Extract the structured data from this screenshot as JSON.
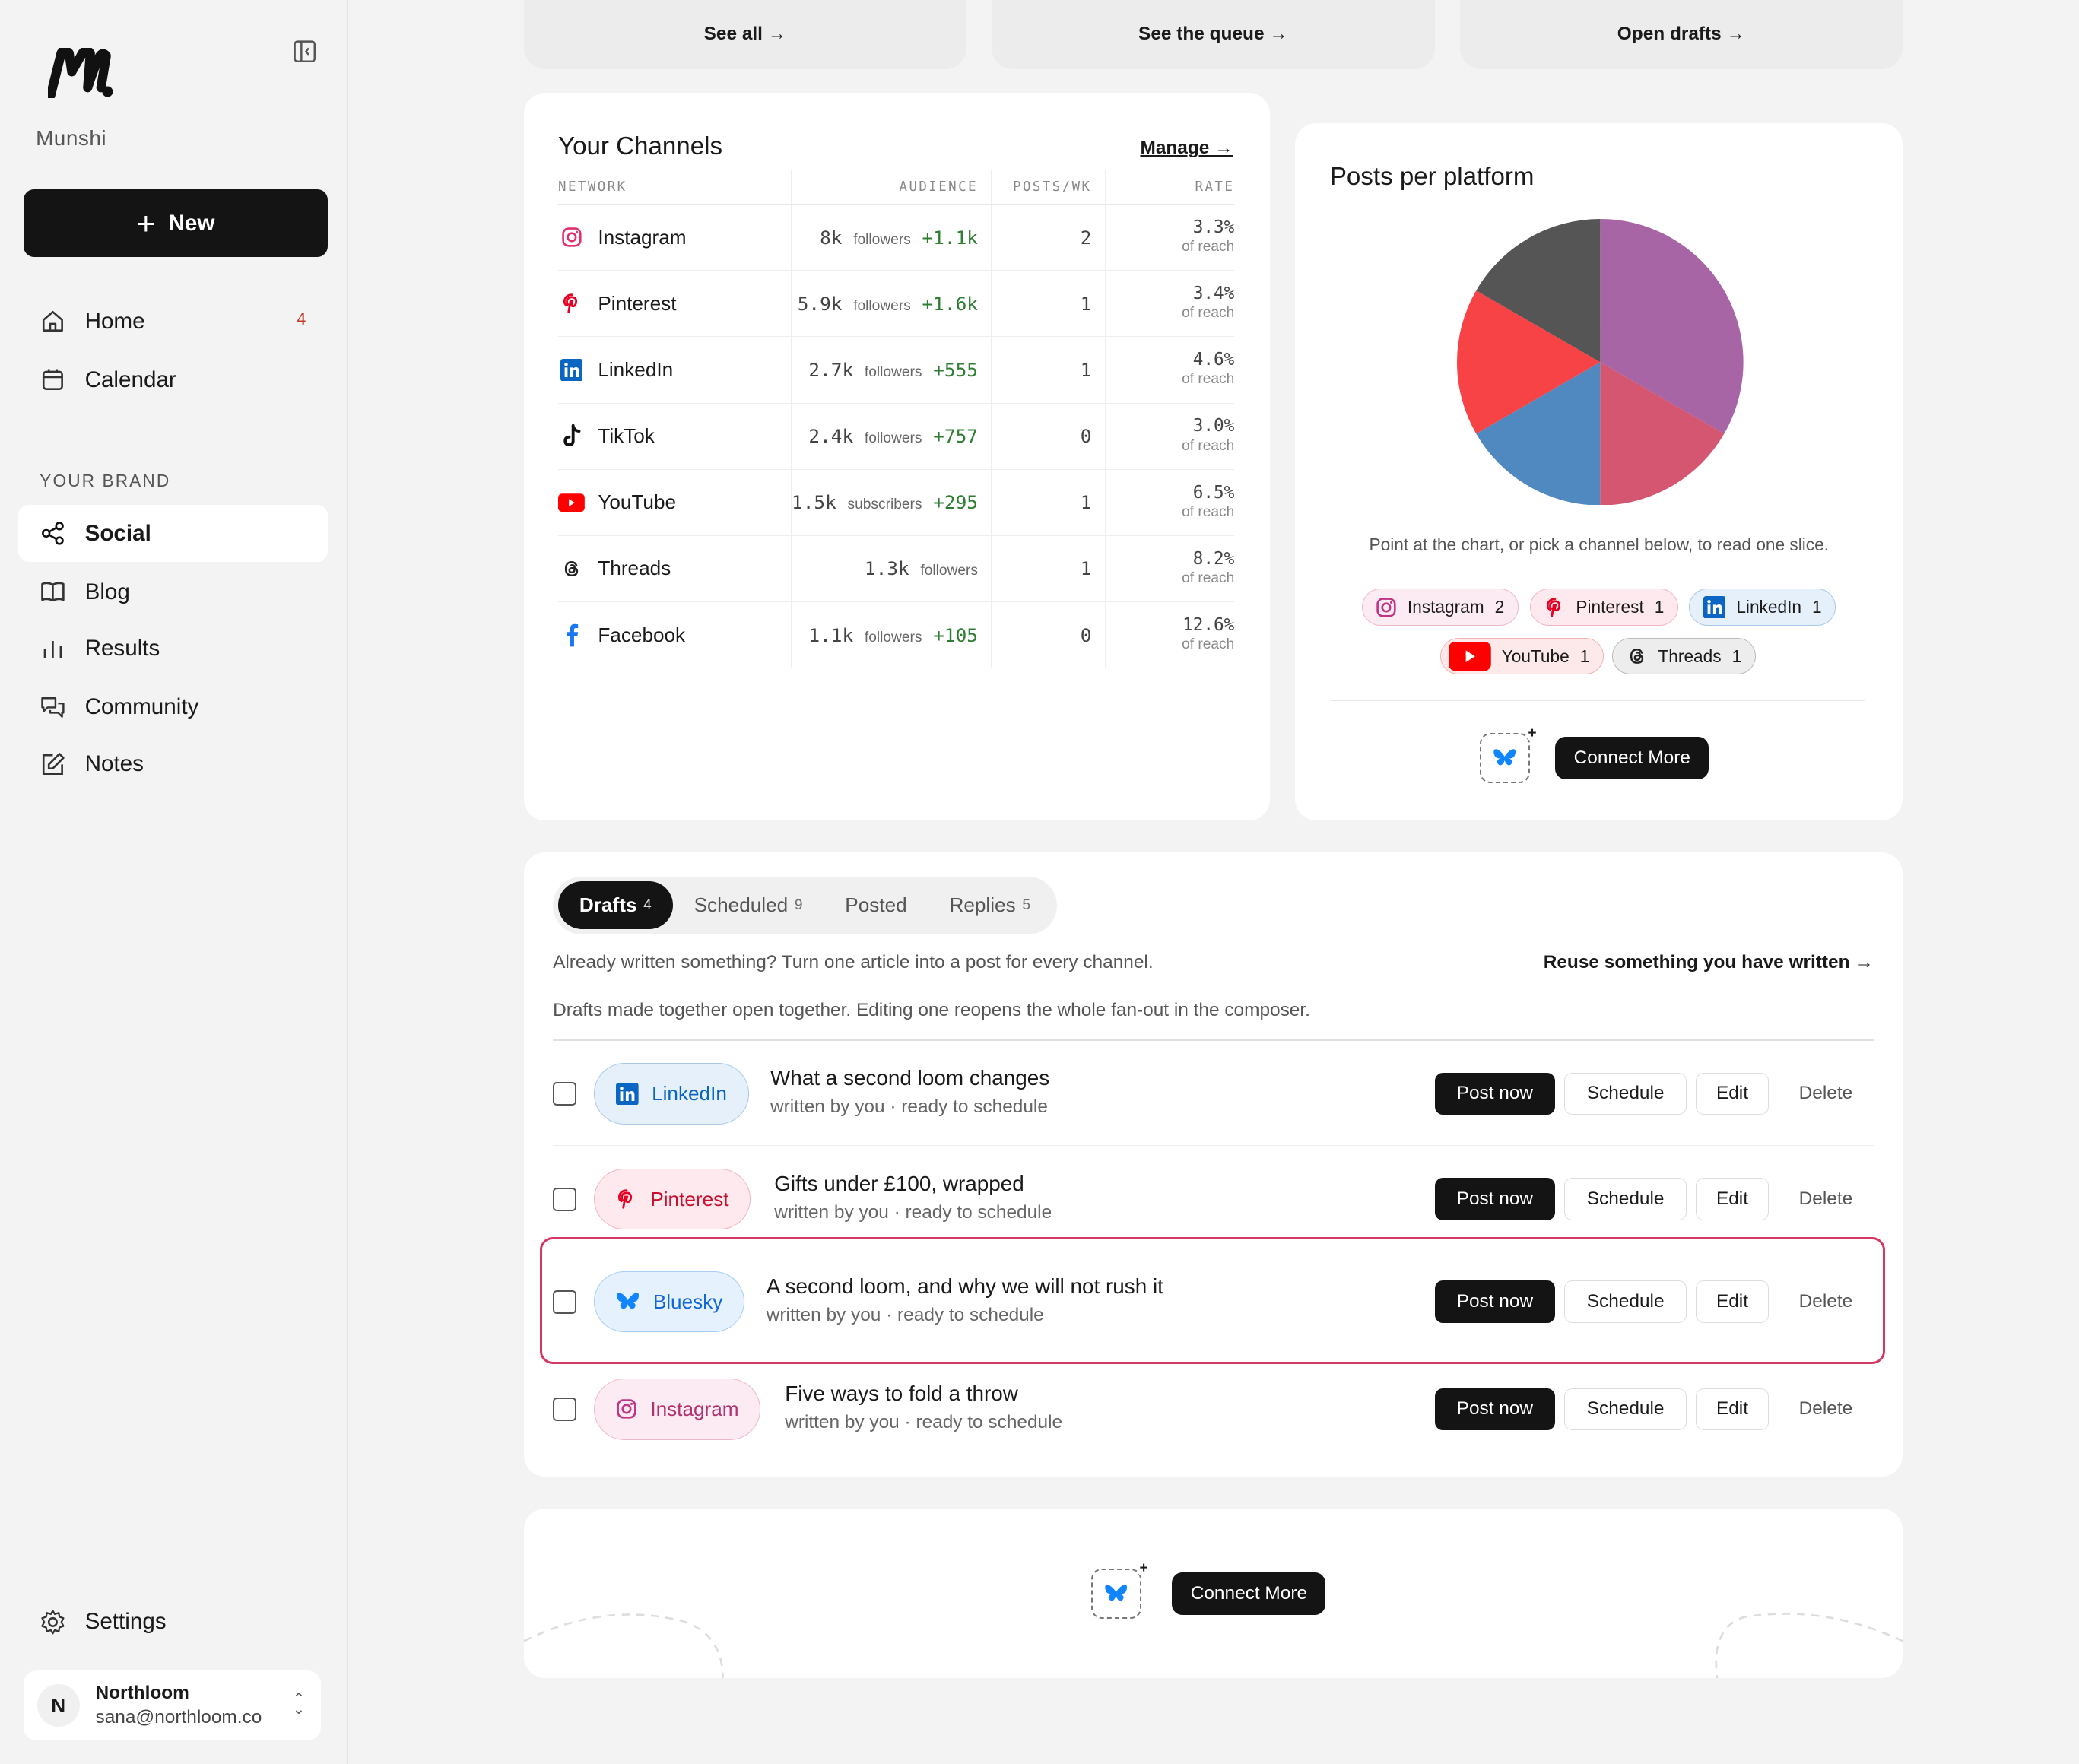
{
  "app": {
    "brand": "Munshi"
  },
  "sidebar": {
    "new_label": "New",
    "nav_top": [
      {
        "label": "Home",
        "badge": "4"
      },
      {
        "label": "Calendar"
      }
    ],
    "section_label": "YOUR BRAND",
    "nav_brand": [
      {
        "label": "Social"
      },
      {
        "label": "Blog"
      },
      {
        "label": "Results"
      },
      {
        "label": "Community"
      },
      {
        "label": "Notes"
      }
    ],
    "settings_label": "Settings",
    "user": {
      "initial": "N",
      "name": "Northloom",
      "email": "sana@northloom.co"
    }
  },
  "top_links": [
    "See all →",
    "See the queue →",
    "Open drafts →"
  ],
  "channels": {
    "title": "Your Channels",
    "manage": "Manage →",
    "headers": [
      "NETWORK",
      "AUDIENCE",
      "POSTS/WK",
      "RATE"
    ],
    "rows": [
      {
        "network": "Instagram",
        "audience": "8k",
        "unit": "followers",
        "delta": "+1.1k",
        "posts": "2",
        "rate": "3.3%",
        "rate_sub": "of reach"
      },
      {
        "network": "Pinterest",
        "audience": "5.9k",
        "unit": "followers",
        "delta": "+1.6k",
        "posts": "1",
        "rate": "3.4%",
        "rate_sub": "of reach"
      },
      {
        "network": "LinkedIn",
        "audience": "2.7k",
        "unit": "followers",
        "delta": "+555",
        "posts": "1",
        "rate": "4.6%",
        "rate_sub": "of reach"
      },
      {
        "network": "TikTok",
        "audience": "2.4k",
        "unit": "followers",
        "delta": "+757",
        "posts": "0",
        "rate": "3.0%",
        "rate_sub": "of reach"
      },
      {
        "network": "YouTube",
        "audience": "1.5k",
        "unit": "subscribers",
        "delta": "+295",
        "posts": "1",
        "rate": "6.5%",
        "rate_sub": "of reach"
      },
      {
        "network": "Threads",
        "audience": "1.3k",
        "unit": "followers",
        "delta": "",
        "posts": "1",
        "rate": "8.2%",
        "rate_sub": "of reach"
      },
      {
        "network": "Facebook",
        "audience": "1.1k",
        "unit": "followers",
        "delta": "+105",
        "posts": "0",
        "rate": "12.6%",
        "rate_sub": "of reach"
      }
    ]
  },
  "posts_per_platform": {
    "title": "Posts per platform",
    "hint": "Point at the chart, or pick a channel below, to read one slice.",
    "chips": [
      {
        "label": "Instagram",
        "count": "2"
      },
      {
        "label": "Pinterest",
        "count": "1"
      },
      {
        "label": "LinkedIn",
        "count": "1"
      },
      {
        "label": "YouTube",
        "count": "1"
      },
      {
        "label": "Threads",
        "count": "1"
      }
    ],
    "connect_label": "Connect More"
  },
  "chart_data": {
    "type": "pie",
    "categories": [
      "Instagram",
      "Pinterest",
      "LinkedIn",
      "YouTube",
      "Threads"
    ],
    "values": [
      2,
      1,
      1,
      1,
      1
    ],
    "colors": [
      "#a865a6",
      "#d45670",
      "#5089c0",
      "#f74346",
      "#555555"
    ]
  },
  "drafts": {
    "tabs": [
      {
        "label": "Drafts",
        "count": "4"
      },
      {
        "label": "Scheduled",
        "count": "9"
      },
      {
        "label": "Posted",
        "count": ""
      },
      {
        "label": "Replies",
        "count": "5"
      }
    ],
    "hint1": "Already written something? Turn one article into a post for every channel.",
    "reuse_link": "Reuse something you have written →",
    "hint2": "Drafts made together open together. Editing one reopens the whole fan-out in the composer.",
    "buttons": {
      "post": "Post now",
      "schedule": "Schedule",
      "edit": "Edit",
      "delete": "Delete"
    },
    "rows": [
      {
        "platform": "LinkedIn",
        "title": "What a second loom changes",
        "sub": "written by you · ready to schedule"
      },
      {
        "platform": "Pinterest",
        "title": "Gifts under £100, wrapped",
        "sub": "written by you · ready to schedule"
      },
      {
        "platform": "Bluesky",
        "title": "A second loom, and why we will not rush it",
        "sub": "written by you · ready to schedule"
      },
      {
        "platform": "Instagram",
        "title": "Five ways to fold a throw",
        "sub": "written by you · ready to schedule"
      }
    ]
  },
  "bottom": {
    "connect_label": "Connect More"
  }
}
